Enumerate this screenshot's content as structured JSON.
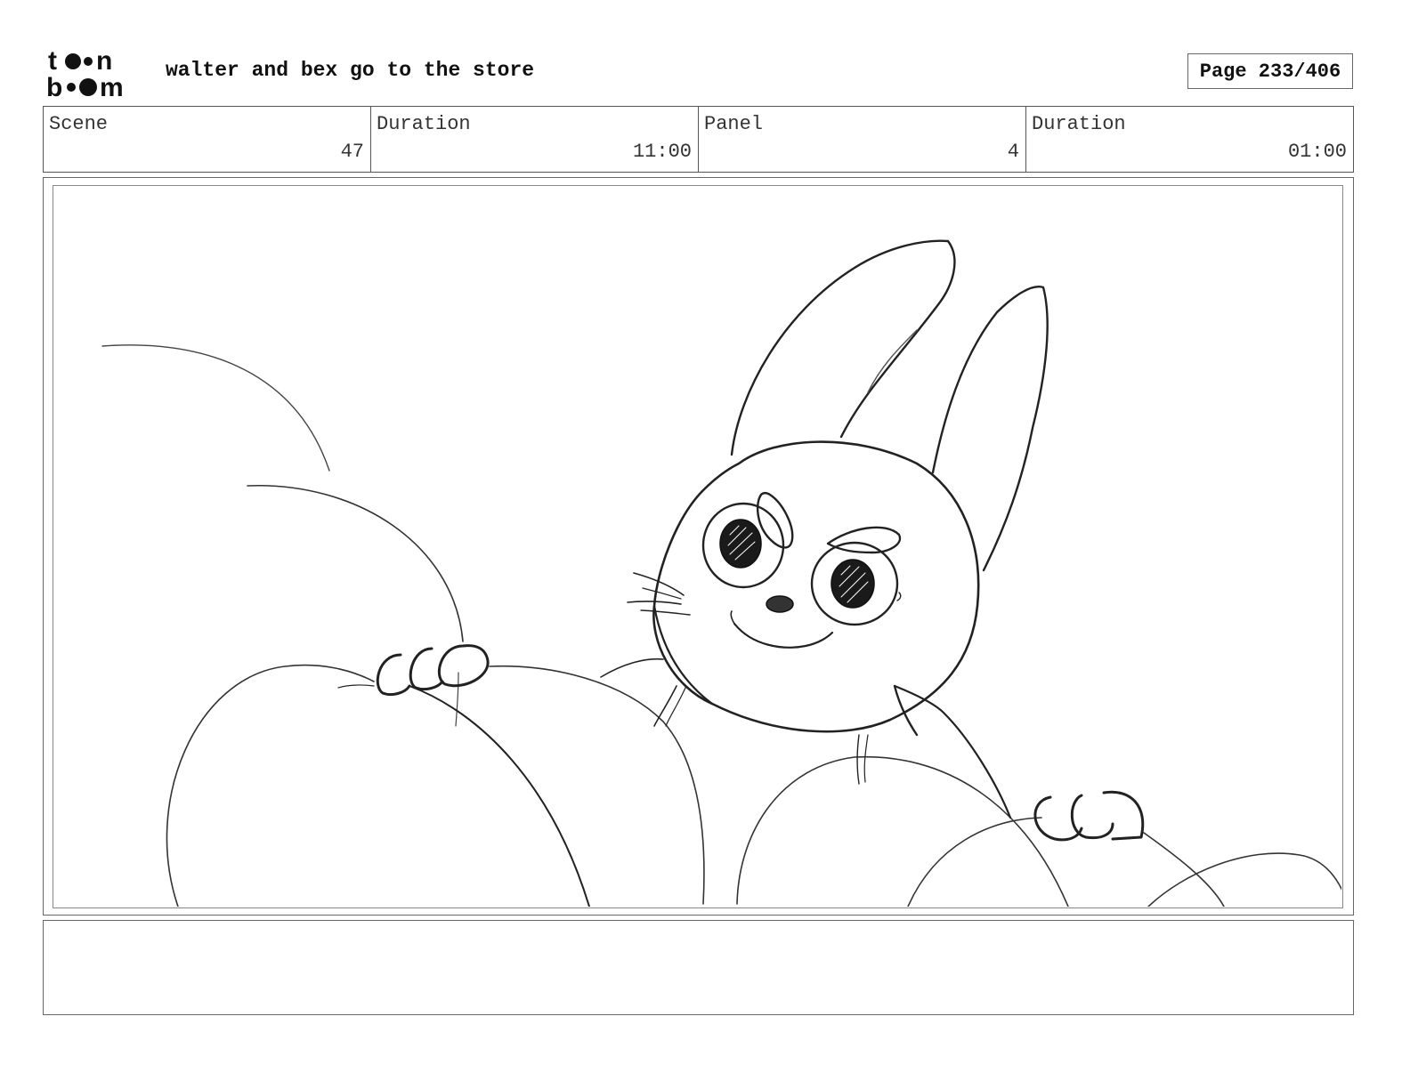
{
  "header": {
    "logo_text_top": "toon",
    "logo_text_bottom": "boom",
    "title": "walter and bex go to the store",
    "page": "Page 233/406"
  },
  "info": {
    "scene_label": "Scene",
    "scene_value": "47",
    "scene_duration_label": "Duration",
    "scene_duration_value": "11:00",
    "panel_label": "Panel",
    "panel_value": "4",
    "panel_duration_label": "Duration",
    "panel_duration_value": "01:00"
  },
  "panel": {
    "drawing": "rabbit-character-sketch"
  },
  "notes": {
    "text": ""
  }
}
